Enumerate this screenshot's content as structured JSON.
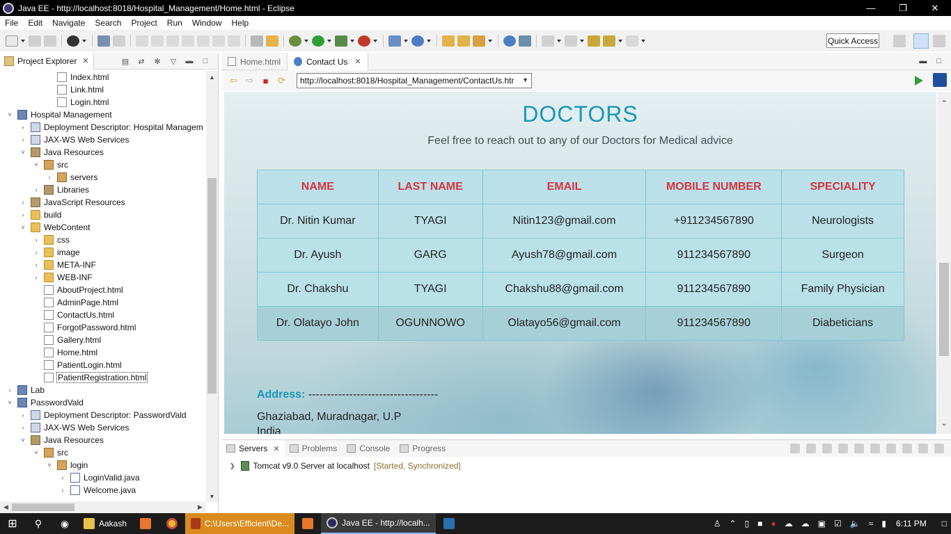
{
  "window": {
    "title": "Java EE - http://localhost:8018/Hospital_Management/Home.html - Eclipse"
  },
  "menu": [
    "File",
    "Edit",
    "Navigate",
    "Search",
    "Project",
    "Run",
    "Window",
    "Help"
  ],
  "toolbar": {
    "quick_access": "Quick Access"
  },
  "explorer": {
    "tab_label": "Project Explorer",
    "tree": [
      {
        "label": "Index.html",
        "icon": "file",
        "depth": 3,
        "twisty": ""
      },
      {
        "label": "Link.html",
        "icon": "file",
        "depth": 3,
        "twisty": ""
      },
      {
        "label": "Login.html",
        "icon": "file",
        "depth": 3,
        "twisty": ""
      },
      {
        "label": "Hospital Management",
        "icon": "project",
        "depth": 0,
        "twisty": "open"
      },
      {
        "label": "Deployment Descriptor: Hospital Managem",
        "icon": "descriptor",
        "depth": 1,
        "twisty": "closed"
      },
      {
        "label": "JAX-WS Web Services",
        "icon": "descriptor",
        "depth": 1,
        "twisty": "closed"
      },
      {
        "label": "Java Resources",
        "icon": "jar",
        "depth": 1,
        "twisty": "open"
      },
      {
        "label": "src",
        "icon": "pkg",
        "depth": 2,
        "twisty": "open"
      },
      {
        "label": "servers",
        "icon": "pkg",
        "depth": 3,
        "twisty": "closed"
      },
      {
        "label": "Libraries",
        "icon": "jar",
        "depth": 2,
        "twisty": "closed"
      },
      {
        "label": "JavaScript Resources",
        "icon": "jar",
        "depth": 1,
        "twisty": "closed"
      },
      {
        "label": "build",
        "icon": "folder",
        "depth": 1,
        "twisty": "closed"
      },
      {
        "label": "WebContent",
        "icon": "folder",
        "depth": 1,
        "twisty": "open"
      },
      {
        "label": "css",
        "icon": "folder",
        "depth": 2,
        "twisty": "closed"
      },
      {
        "label": "image",
        "icon": "folder",
        "depth": 2,
        "twisty": "closed"
      },
      {
        "label": "META-INF",
        "icon": "folder",
        "depth": 2,
        "twisty": "closed"
      },
      {
        "label": "WEB-INF",
        "icon": "folder",
        "depth": 2,
        "twisty": "closed"
      },
      {
        "label": "AboutProject.html",
        "icon": "file",
        "depth": 2,
        "twisty": ""
      },
      {
        "label": "AdminPage.html",
        "icon": "file",
        "depth": 2,
        "twisty": ""
      },
      {
        "label": "ContactUs.html",
        "icon": "file",
        "depth": 2,
        "twisty": ""
      },
      {
        "label": "ForgotPassword.html",
        "icon": "file",
        "depth": 2,
        "twisty": ""
      },
      {
        "label": "Gallery.html",
        "icon": "file",
        "depth": 2,
        "twisty": ""
      },
      {
        "label": "Home.html",
        "icon": "file",
        "depth": 2,
        "twisty": ""
      },
      {
        "label": "PatientLogin.html",
        "icon": "file",
        "depth": 2,
        "twisty": ""
      },
      {
        "label": "PatientRegistration.html",
        "icon": "file",
        "depth": 2,
        "twisty": "",
        "selected": true
      },
      {
        "label": "Lab",
        "icon": "project",
        "depth": 0,
        "twisty": "closed"
      },
      {
        "label": "PasswordVald",
        "icon": "project",
        "depth": 0,
        "twisty": "open"
      },
      {
        "label": "Deployment Descriptor: PasswordVald",
        "icon": "descriptor",
        "depth": 1,
        "twisty": "closed"
      },
      {
        "label": "JAX-WS Web Services",
        "icon": "descriptor",
        "depth": 1,
        "twisty": "closed"
      },
      {
        "label": "Java Resources",
        "icon": "jar",
        "depth": 1,
        "twisty": "open"
      },
      {
        "label": "src",
        "icon": "pkg",
        "depth": 2,
        "twisty": "open"
      },
      {
        "label": "login",
        "icon": "pkg",
        "depth": 3,
        "twisty": "open"
      },
      {
        "label": "LoginValid.java",
        "icon": "java",
        "depth": 4,
        "twisty": "closed"
      },
      {
        "label": "Welcome.java",
        "icon": "java",
        "depth": 4,
        "twisty": "closed"
      }
    ]
  },
  "editor": {
    "tabs": [
      {
        "label": "Home.html",
        "active": false
      },
      {
        "label": "Contact Us",
        "active": true
      }
    ],
    "url": "http://localhost:8018/Hospital_Management/ContactUs.htr"
  },
  "webpage": {
    "title": "DOCTORS",
    "subtitle": "Feel free to reach out to any of our Doctors for Medical advice",
    "columns": [
      "NAME",
      "LAST NAME",
      "EMAIL",
      "MOBILE NUMBER",
      "SPECIALITY"
    ],
    "rows": [
      [
        "Dr. Nitin Kumar",
        "TYAGI",
        "Nitin123@gmail.com",
        "+911234567890",
        "Neurologists"
      ],
      [
        "Dr. Ayush",
        "GARG",
        "Ayush78@gmail.com",
        "911234567890",
        "Surgeon"
      ],
      [
        "Dr. Chakshu",
        "TYAGI",
        "Chakshu88@gmail.com",
        "911234567890",
        "Family Physician"
      ],
      [
        "Dr. Olatayo John",
        "OGUNNOWO",
        "Olatayo56@gmail.com",
        "911234567890",
        "Diabeticians"
      ]
    ],
    "address_label": "Address:",
    "address_dashes": "-----------------------------------",
    "address_line1": "Ghaziabad, Muradnagar, U.P",
    "address_line2": "India"
  },
  "bottom_panel": {
    "tabs": [
      {
        "label": "Servers",
        "active": true
      },
      {
        "label": "Problems",
        "active": false
      },
      {
        "label": "Console",
        "active": false
      },
      {
        "label": "Progress",
        "active": false
      }
    ],
    "server": "Tomcat v9.0 Server at localhost",
    "server_status": "[Started, Synchronized]"
  },
  "taskbar": {
    "apps": [
      {
        "label": "Aakash",
        "icon": "folder-icon"
      },
      {
        "label": "C:\\Users\\Efficient\\De...",
        "icon": "terminal-icon"
      },
      {
        "label": "Java EE - http://localh...",
        "icon": "eclipse-icon"
      }
    ],
    "clock": "6:11 PM"
  },
  "colors": {
    "heading": "#1a97b5",
    "table_header_text": "#d8333f",
    "table_bg": "#b8e0e8"
  }
}
